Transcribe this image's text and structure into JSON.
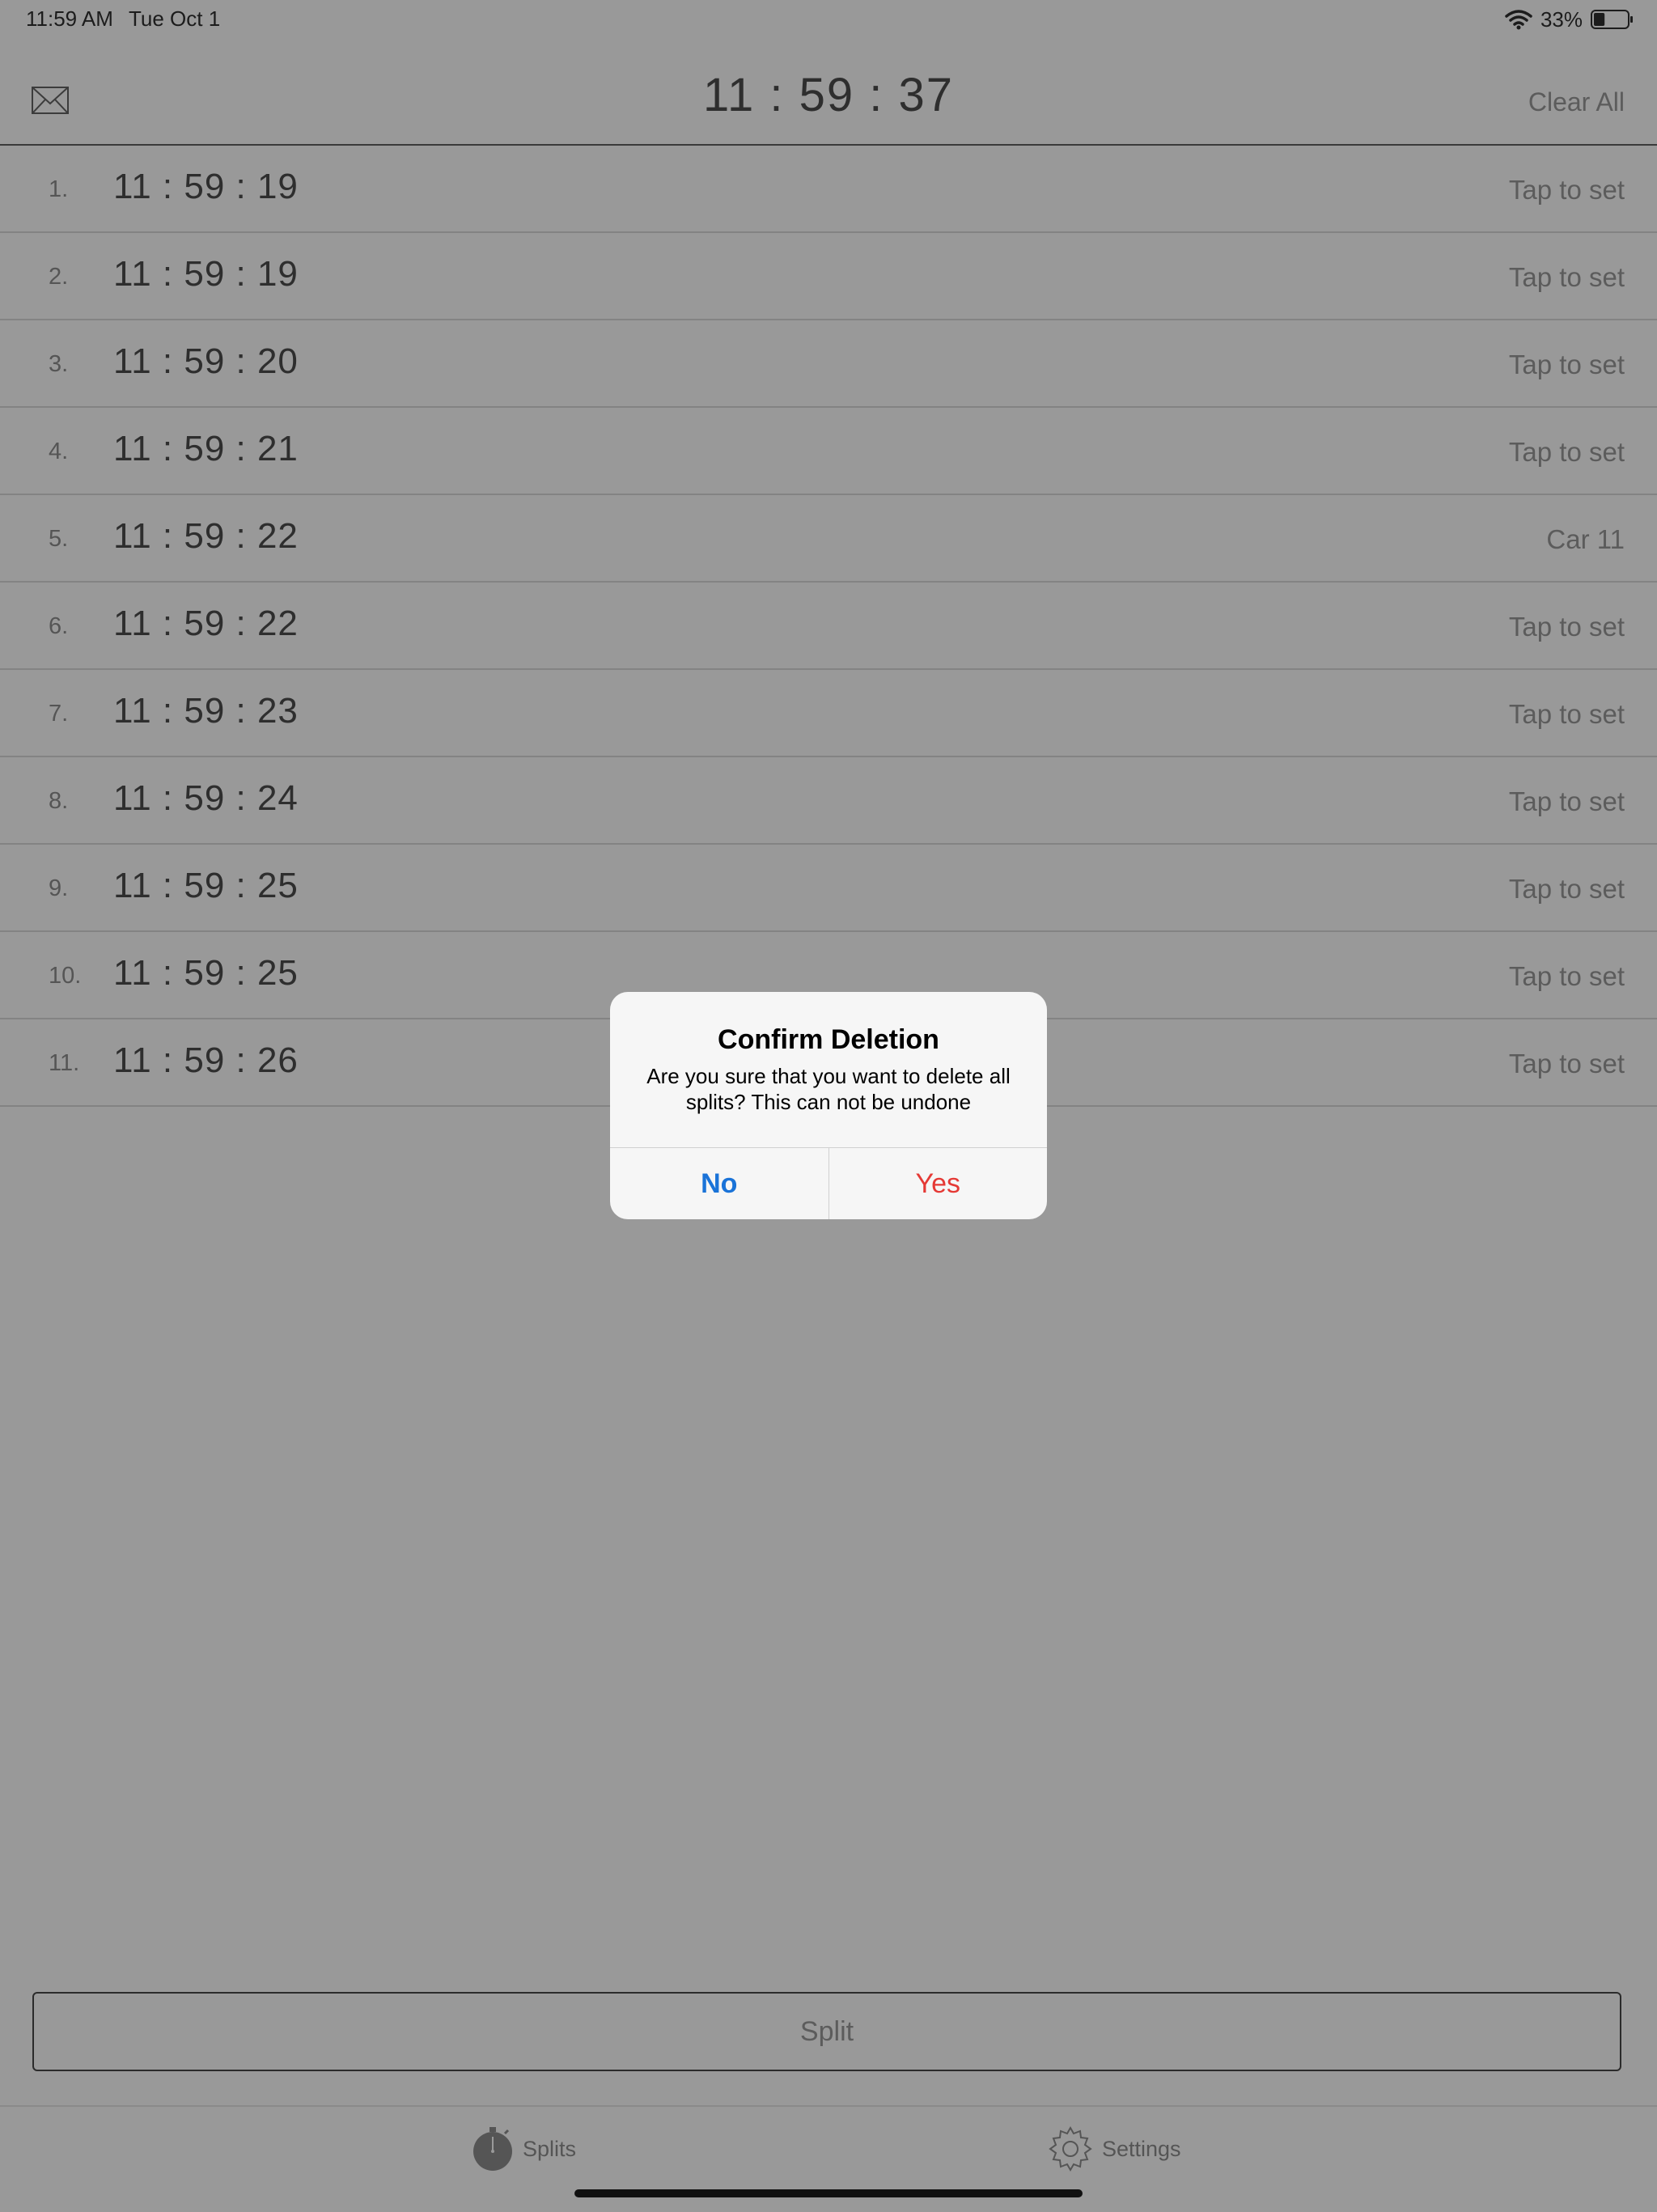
{
  "status_bar": {
    "time": "11:59 AM",
    "date": "Tue Oct 1",
    "battery_percent": "33%",
    "battery_level": 0.33,
    "icons": [
      "wifi-icon",
      "battery-icon"
    ]
  },
  "nav": {
    "title": "11 : 59 : 37",
    "clear_all": "Clear All",
    "left_icon": "mail-icon"
  },
  "splits": [
    {
      "index": "1.",
      "time": "11 : 59 : 19",
      "label": "Tap to set"
    },
    {
      "index": "2.",
      "time": "11 : 59 : 19",
      "label": "Tap to set"
    },
    {
      "index": "3.",
      "time": "11 : 59 : 20",
      "label": "Tap to set"
    },
    {
      "index": "4.",
      "time": "11 : 59 : 21",
      "label": "Tap to set"
    },
    {
      "index": "5.",
      "time": "11 : 59 : 22",
      "label": "Car 11"
    },
    {
      "index": "6.",
      "time": "11 : 59 : 22",
      "label": "Tap to set"
    },
    {
      "index": "7.",
      "time": "11 : 59 : 23",
      "label": "Tap to set"
    },
    {
      "index": "8.",
      "time": "11 : 59 : 24",
      "label": "Tap to set"
    },
    {
      "index": "9.",
      "time": "11 : 59 : 25",
      "label": "Tap to set"
    },
    {
      "index": "10.",
      "time": "11 : 59 : 25",
      "label": "Tap to set"
    },
    {
      "index": "11.",
      "time": "11 : 59 : 26",
      "label": "Tap to set"
    }
  ],
  "split_button": {
    "label": "Split"
  },
  "tabs": [
    {
      "label": "Splits",
      "icon": "stopwatch-icon"
    },
    {
      "label": "Settings",
      "icon": "gear-icon"
    }
  ],
  "alert": {
    "title": "Confirm Deletion",
    "message": "Are you sure that you want to delete all splits? This can not be undone",
    "no_label": "No",
    "yes_label": "Yes",
    "no_color": "#1a73d8",
    "yes_color": "#e53935"
  },
  "colors": {
    "background_dimmed": "#999999"
  }
}
